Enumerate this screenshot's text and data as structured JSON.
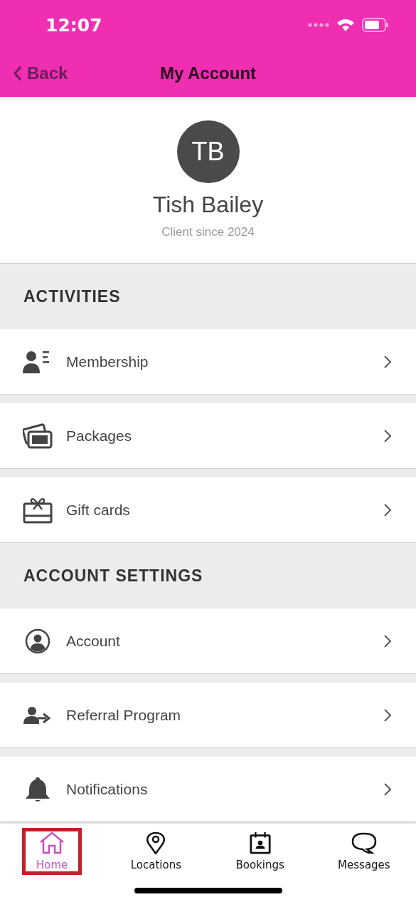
{
  "status_bar": {
    "time": "12:07"
  },
  "nav": {
    "back": "Back",
    "title": "My Account"
  },
  "profile": {
    "initials": "TB",
    "name": "Tish Bailey",
    "since": "Client since 2024"
  },
  "sections": [
    {
      "title": "ACTIVITIES",
      "items": [
        {
          "label": "Membership"
        },
        {
          "label": "Packages"
        },
        {
          "label": "Gift cards"
        }
      ]
    },
    {
      "title": "ACCOUNT SETTINGS",
      "items": [
        {
          "label": "Account"
        },
        {
          "label": "Referral Program"
        },
        {
          "label": "Notifications"
        }
      ]
    }
  ],
  "tabs": [
    {
      "label": "Home",
      "selected": true,
      "highlighted": true
    },
    {
      "label": "Locations",
      "selected": false,
      "highlighted": false
    },
    {
      "label": "Bookings",
      "selected": false,
      "highlighted": false
    },
    {
      "label": "Messages",
      "selected": false,
      "highlighted": false
    }
  ]
}
